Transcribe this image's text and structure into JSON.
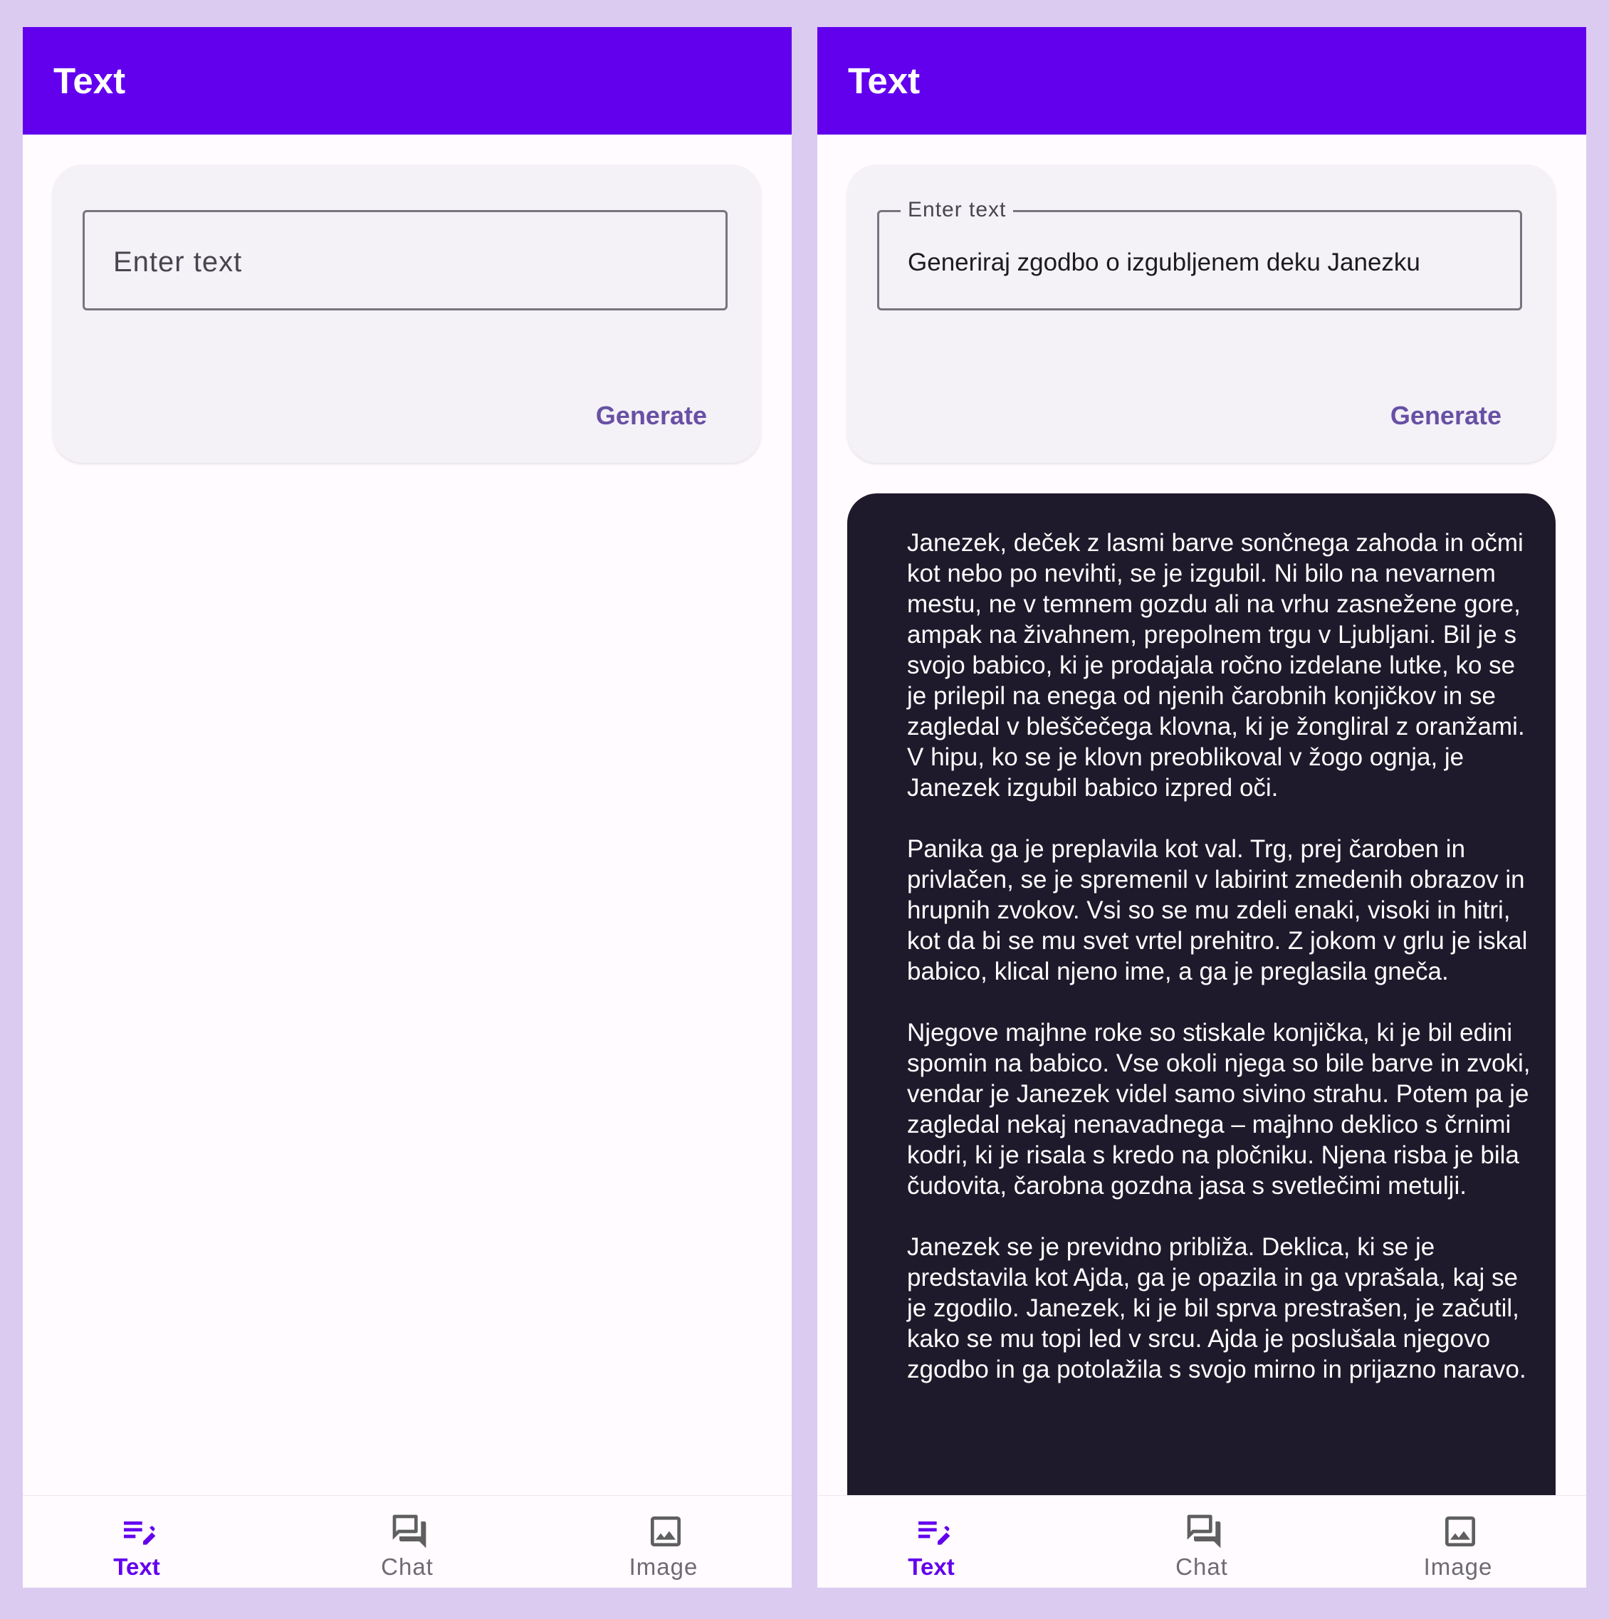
{
  "colors": {
    "primary": "#6200ee",
    "accent_text": "#6750a4",
    "background": "#fffbfe",
    "result_card": "#1e1a2b",
    "inactive_nav": "#6f6a75"
  },
  "left": {
    "app_bar": {
      "title": "Text"
    },
    "prompt": {
      "placeholder": "Enter text",
      "value": ""
    },
    "generate_label": "Generate",
    "nav": [
      {
        "label": "Text",
        "icon": "edit-note-icon",
        "active": true
      },
      {
        "label": "Chat",
        "icon": "forum-icon",
        "active": false
      },
      {
        "label": "Image",
        "icon": "image-icon",
        "active": false
      }
    ]
  },
  "right": {
    "app_bar": {
      "title": "Text"
    },
    "prompt": {
      "label": "Enter text",
      "value": "Generiraj zgodbo o izgubljenem deku Janezku"
    },
    "generate_label": "Generate",
    "result": {
      "paragraphs": [
        "Janezek, deček z lasmi barve sončnega zahoda in očmi kot nebo po nevihti, se je izgubil. Ni bilo na nevarnem mestu, ne v temnem gozdu ali na vrhu zasnežene gore, ampak na živahnem, prepolnem trgu v Ljubljani.  Bil je s svojo babico, ki je prodajala ročno izdelane lutke, ko se je prilepil na enega od njenih čarobnih konjičkov in se zagledal v bleščečega klovna, ki je žongliral z oranžami.  V hipu, ko se je klovn preoblikoval v žogo ognja, je Janezek izgubil babico izpred oči.",
        "Panika ga je preplavila kot val.  Trg, prej čaroben in privlačen, se je spremenil v labirint zmedenih obrazov in hrupnih zvokov.  Vsi so se mu zdeli enaki, visoki in hitri, kot da bi se mu svet vrtel prehitro.  Z jokom v grlu je iskal babico, klical njeno ime, a ga je preglasila gneča.",
        "Njegove majhne roke so stiskale konjička, ki je bil edini spomin na babico.  Vse okoli njega so bile barve in zvoki, vendar je Janezek videl samo sivino strahu.  Potem pa je zagledal nekaj nenavadnega – majhno deklico s črnimi kodri, ki je risala s kredo na pločniku.  Njena risba je bila čudovita, čarobna gozdna jasa s svetlečimi metulji.",
        "Janezek se je previdno približa.  Deklica, ki se je predstavila kot Ajda, ga je opazila in ga vprašala, kaj se je zgodilo.  Janezek, ki je bil sprva prestrašen, je začutil, kako se mu topi led v srcu.  Ajda je poslušala njegovo zgodbo in ga potolažila s svojo mirno in prijazno naravo."
      ]
    },
    "nav": [
      {
        "label": "Text",
        "icon": "edit-note-icon",
        "active": true
      },
      {
        "label": "Chat",
        "icon": "forum-icon",
        "active": false
      },
      {
        "label": "Image",
        "icon": "image-icon",
        "active": false
      }
    ]
  }
}
